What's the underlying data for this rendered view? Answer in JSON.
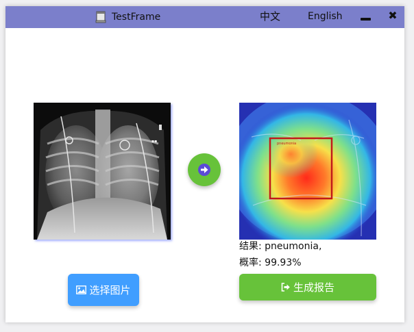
{
  "window": {
    "title": "TestFrame",
    "title_icon": "app-window-icon",
    "lang_zh": "中文",
    "lang_en": "English",
    "minimize_icon": "minimize-icon",
    "close_icon": "close-icon",
    "close_glyph": "✖",
    "titlebar_color": "#7b7fcb"
  },
  "main": {
    "input_image": "chest-xray-image",
    "output_image": "heatmap-xray-image",
    "detection_label": "pneumonia",
    "arrow_icon": "arrow-right-icon",
    "result_label": "结果: pneumonia,",
    "probability_label": "概率: 99.93%",
    "select_button": "选择图片",
    "select_icon": "image-icon",
    "report_button": "生成报告",
    "report_icon": "sign-out-icon",
    "colors": {
      "primary_blue": "#409eff",
      "success_green": "#67c23a"
    }
  }
}
